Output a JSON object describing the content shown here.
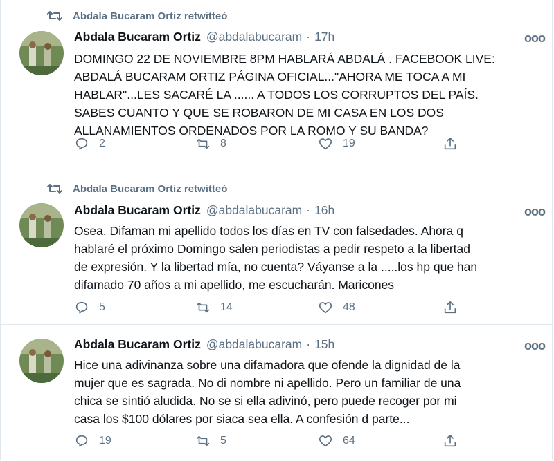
{
  "retweet_label": "Abdala Bucaram Ortiz retwitteó",
  "colors": {
    "secondary": "#5b7083",
    "border": "#e1e8ed",
    "text": "#0f1419"
  },
  "tweets": [
    {
      "retweeted": true,
      "name": "Abdala Bucaram Ortiz",
      "handle": "@abdalabucaram",
      "dot": "·",
      "time": "17h",
      "more": "ooo",
      "lines": [
        "DOMINGO 22 DE NOVIEMBRE 8PM HABLARÁ ABDALÁ . FACEBOOK LIVE:",
        "ABDALÁ BUCARAM ORTIZ PÁGINA OFICIAL...\"AHORA ME TOCA A MI",
        "HABLAR\"...LES SACARÉ LA ...... A TODOS LOS CORRUPTOS DEL PAÍS.",
        "SABES CUANTO Y QUE SE ROBARON DE MI CASA EN LOS DOS",
        "ALLANAMIENTOS ORDENADOS POR LA ROMO Y SU BANDA?"
      ],
      "replies": "2",
      "retweets": "8",
      "likes": "19"
    },
    {
      "retweeted": true,
      "name": "Abdala Bucaram Ortiz",
      "handle": "@abdalabucaram",
      "dot": "·",
      "time": "16h",
      "more": "ooo",
      "lines": [
        "Osea. Difaman mi apellido todos los días en TV con falsedades. Ahora q",
        "hablaré el próximo Domingo salen periodistas a pedir respeto a la libertad",
        "de expresión. Y la libertad mía, no cuenta? Váyanse a la .....los hp que han",
        "difamado 70 años a mi apellido, me escucharán. Maricones"
      ],
      "replies": "5",
      "retweets": "14",
      "likes": "48"
    },
    {
      "retweeted": false,
      "name": "Abdala Bucaram Ortiz",
      "handle": "@abdalabucaram",
      "dot": "·",
      "time": "15h",
      "more": "ooo",
      "lines": [
        "Hice una adivinanza sobre una difamadora que ofende la dignidad de la",
        "mujer que es sagrada. No di nombre ni apellido. Pero un familiar de una",
        "chica se sintió aludida. No se si ella adivinó, pero puede recoger por mi",
        "casa los $100 dólares por siaca sea ella. A confesión d parte..."
      ],
      "replies": "19",
      "retweets": "5",
      "likes": "64"
    }
  ]
}
